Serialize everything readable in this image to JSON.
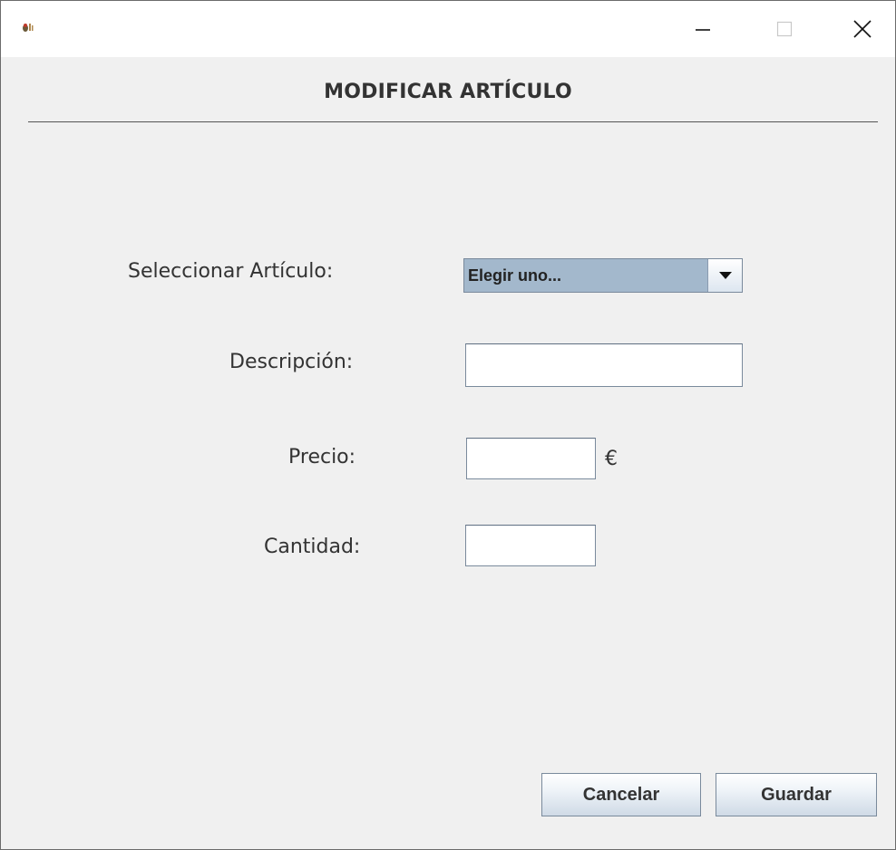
{
  "window": {
    "title_text": "",
    "icon": "duke-java-icon"
  },
  "form": {
    "title": "MODIFICAR ARTÍCULO",
    "select_label": "Seleccionar Artículo:",
    "select_value": "Elegir uno...",
    "descripcion_label": "Descripción:",
    "descripcion_value": "",
    "precio_label": "Precio:",
    "precio_value": "",
    "precio_unit": "€",
    "cantidad_label": "Cantidad:",
    "cantidad_value": ""
  },
  "buttons": {
    "cancel_label": "Cancelar",
    "save_label": "Guardar"
  },
  "colors": {
    "combo_selection": "#a3b8cc",
    "background": "#f0f0f0"
  }
}
